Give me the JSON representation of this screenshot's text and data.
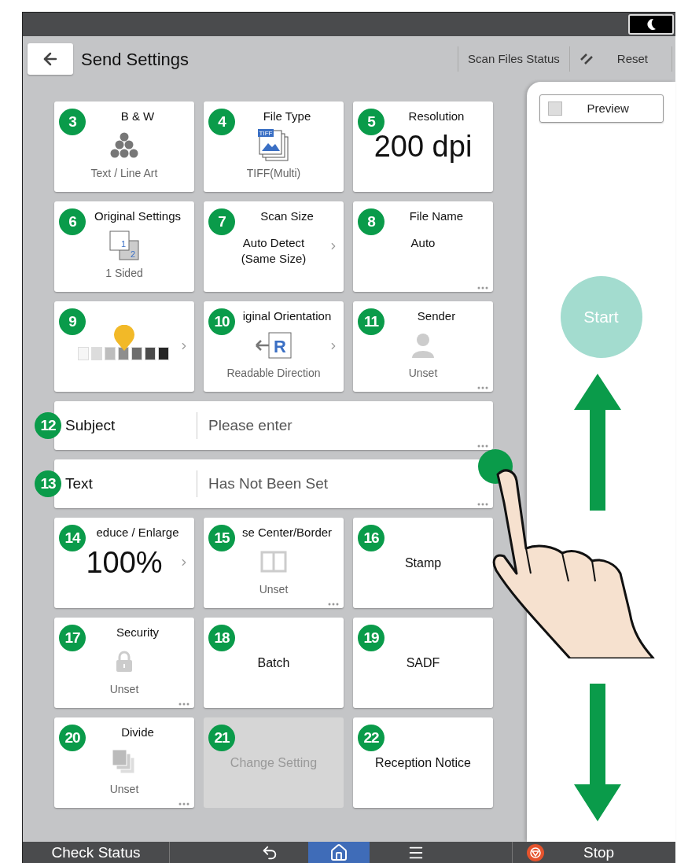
{
  "header": {
    "title": "Send Settings",
    "links": [
      "Scan Files Status",
      "Reset"
    ]
  },
  "settings": [
    {
      "kind": "mode",
      "callout": "3",
      "title": "B & W",
      "value": "Text / Line Art",
      "chevron": false,
      "more": false
    },
    {
      "kind": "filetype",
      "callout": "4",
      "title": "File Type",
      "icon_text": [
        "TIFF"
      ],
      "value": "TIFF(Multi)",
      "chevron": false,
      "more": false
    },
    {
      "kind": "big",
      "callout": "5",
      "title": "Resolution",
      "value": "200 dpi",
      "chevron": false,
      "more": false
    },
    {
      "kind": "sides",
      "callout": "6",
      "title": "Original Settings",
      "icon_text": [
        "1",
        "2"
      ],
      "value": "1 Sided",
      "chevron": false,
      "more": false
    },
    {
      "kind": "text",
      "callout": "7",
      "title": "Scan Size",
      "value": "Auto Detect (Same Size)",
      "chevron": true,
      "more": false
    },
    {
      "kind": "text",
      "callout": "8",
      "title": "File Name",
      "value": "Auto",
      "chevron": false,
      "more": true
    },
    {
      "kind": "density",
      "callout": "9",
      "level": 0.5,
      "chevron": true,
      "more": false
    },
    {
      "kind": "orientation",
      "callout": "10",
      "title": "iginal Orientation",
      "icon_text": [
        "R"
      ],
      "value": "Readable Direction",
      "chevron": true,
      "more": false
    },
    {
      "kind": "sender",
      "callout": "11",
      "title": "Sender",
      "value": "Unset",
      "chevron": false,
      "more": true
    },
    {
      "kind": "field",
      "callout": "12",
      "title": "Subject",
      "value": "Please enter",
      "more": true
    },
    {
      "kind": "field",
      "callout": "13",
      "title": "Text",
      "value": "Has Not Been Set",
      "more": true
    },
    {
      "kind": "big",
      "callout": "14",
      "title": "educe / Enlarge",
      "value": "100%",
      "chevron": true,
      "more": false
    },
    {
      "kind": "erase",
      "callout": "15",
      "title": "se Center/Border",
      "value": "Unset",
      "chevron": false,
      "more": true
    },
    {
      "kind": "label",
      "callout": "16",
      "title": "Stamp",
      "disabled": false,
      "more": false
    },
    {
      "kind": "security",
      "callout": "17",
      "title": "Security",
      "value": "Unset",
      "chevron": false,
      "more": true
    },
    {
      "kind": "label",
      "callout": "18",
      "title": "Batch",
      "disabled": false,
      "more": false
    },
    {
      "kind": "label",
      "callout": "19",
      "title": "SADF",
      "disabled": false,
      "more": false
    },
    {
      "kind": "divide",
      "callout": "20",
      "title": "Divide",
      "value": "Unset",
      "chevron": false,
      "more": true
    },
    {
      "kind": "label",
      "callout": "21",
      "title": "Change Setting",
      "disabled": true,
      "more": false
    },
    {
      "kind": "label",
      "callout": "22",
      "title": "Reception Notice",
      "disabled": false,
      "more": false
    }
  ],
  "preview": {
    "label": "Preview",
    "checked": false
  },
  "start": {
    "label": "Start",
    "disabled": true
  },
  "bottom_bar": {
    "check_status": "Check Status",
    "stop": "Stop"
  }
}
